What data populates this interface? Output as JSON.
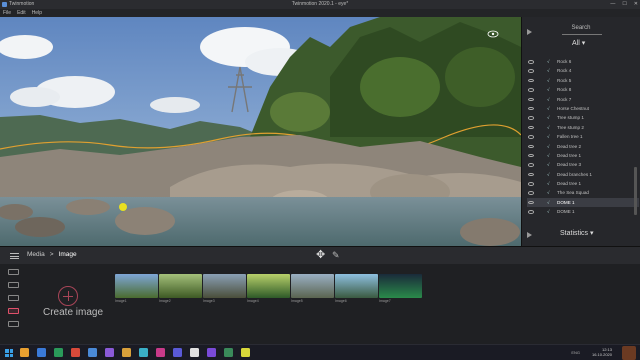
{
  "window": {
    "app_name": "Twinmotion",
    "title": "Twinmotion 2020.1 - eye*",
    "controls": [
      "—",
      "☐",
      "✕"
    ]
  },
  "menu": [
    "File",
    "Edit",
    "Help"
  ],
  "right_panel": {
    "search_label": "Search",
    "filter": "All ▾",
    "items": [
      {
        "name": "Rock 6",
        "selected": false
      },
      {
        "name": "Rock 4",
        "selected": false
      },
      {
        "name": "Rock 5",
        "selected": false
      },
      {
        "name": "Rock 8",
        "selected": false
      },
      {
        "name": "Rock 7",
        "selected": false
      },
      {
        "name": "Horse Chestnut",
        "selected": false
      },
      {
        "name": "Tree stump 1",
        "selected": false
      },
      {
        "name": "Tree stump 2",
        "selected": false
      },
      {
        "name": "Fallen tree 1",
        "selected": false
      },
      {
        "name": "Dead tree 2",
        "selected": false
      },
      {
        "name": "Dead tree 1",
        "selected": false
      },
      {
        "name": "Dead tree 3",
        "selected": false
      },
      {
        "name": "Dead branches 1",
        "selected": false
      },
      {
        "name": "Dead tree 1",
        "selected": false
      },
      {
        "name": "The Sea Squad",
        "selected": false
      },
      {
        "name": "DOME 1",
        "selected": true
      },
      {
        "name": "DOME 1",
        "selected": false
      }
    ],
    "stats_label": "Statistics ▾"
  },
  "toolbar": {
    "crumb_root": "Media",
    "crumb_sep": ">",
    "crumb_current": "Image"
  },
  "media": {
    "create_label": "Create image",
    "thumbnails": [
      {
        "label": "Image1",
        "color_top": "#7ea6d6",
        "color_bottom": "#4a6b2e"
      },
      {
        "label": "Image2",
        "color_top": "#a4c07a",
        "color_bottom": "#3e5a24"
      },
      {
        "label": "Image3",
        "color_top": "#8aa0b6",
        "color_bottom": "#4a4e3a"
      },
      {
        "label": "Image4",
        "color_top": "#b8d06a",
        "color_bottom": "#2e5a28"
      },
      {
        "label": "Image5",
        "color_top": "#9ab0c4",
        "color_bottom": "#5a6450"
      },
      {
        "label": "Image6",
        "color_top": "#8ec0e0",
        "color_bottom": "#3a5a40"
      },
      {
        "label": "Image7",
        "color_top": "#1a2a3a",
        "color_bottom": "#2a8a4a"
      }
    ]
  },
  "taskbar": {
    "time": "12:13",
    "date": "16.10.2020",
    "lang": "ENG",
    "app_colors": [
      "#e8a030",
      "#3a7ad8",
      "#2a9a5a",
      "#d84a3a",
      "#4a8ad8",
      "#8a5ad8",
      "#d8a03a",
      "#3ab0c8",
      "#c83a8a",
      "#5a5ad8",
      "#e0e0e0",
      "#7a4ad8",
      "#3a8a5a",
      "#d8d83a"
    ]
  }
}
